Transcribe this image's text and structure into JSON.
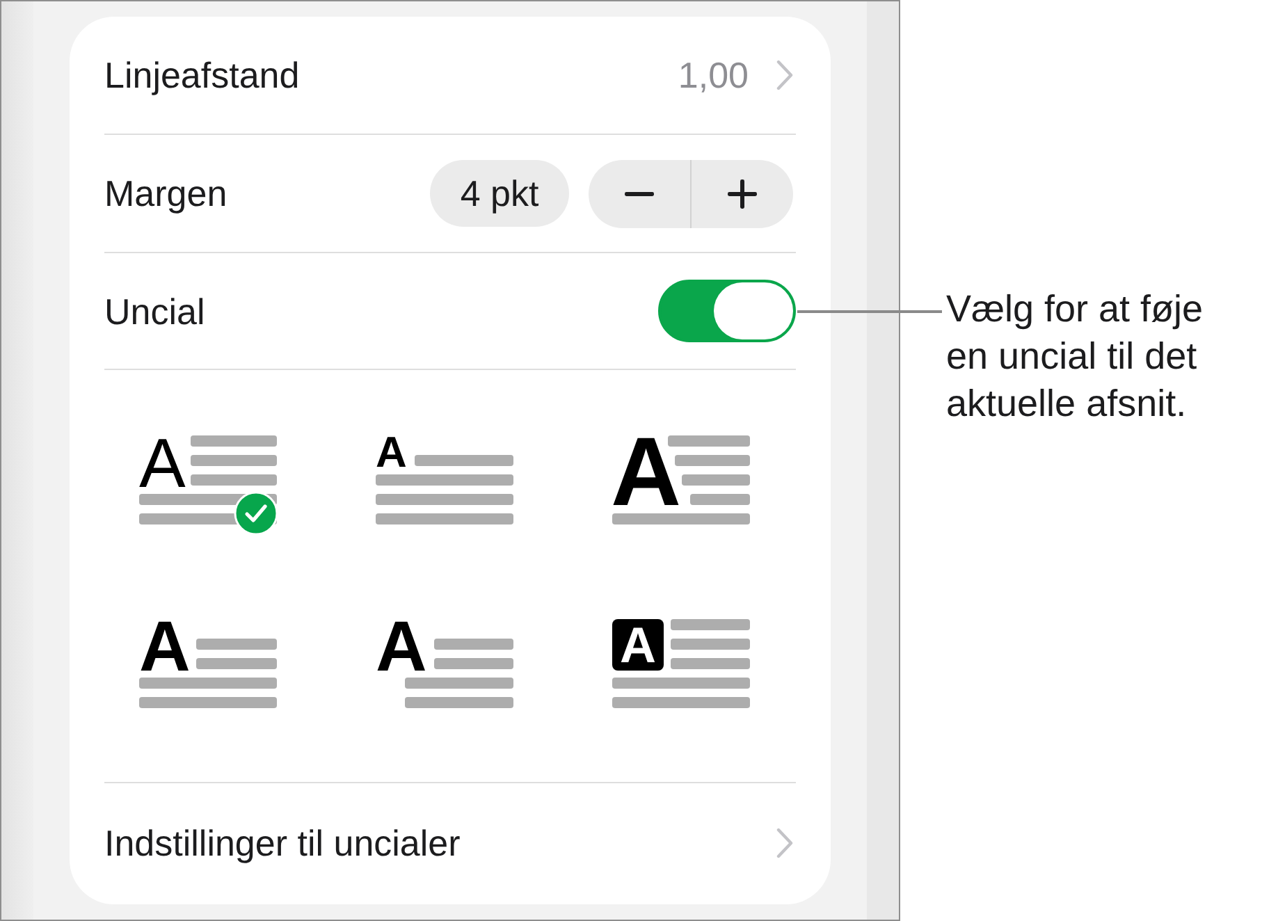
{
  "line_spacing": {
    "label": "Linjeafstand",
    "value": "1,00"
  },
  "margin": {
    "label": "Margen",
    "value": "4 pkt"
  },
  "drop_cap": {
    "label": "Uncial",
    "on": true
  },
  "drop_cap_styles": [
    {
      "kind": "light",
      "letter": "A",
      "selected": true
    },
    {
      "kind": "raised",
      "letter": "A",
      "selected": false
    },
    {
      "kind": "tall",
      "letter": "A",
      "selected": false
    },
    {
      "kind": "dropped",
      "letter": "A",
      "selected": false
    },
    {
      "kind": "hanging",
      "letter": "A",
      "selected": false
    },
    {
      "kind": "boxed",
      "letter": "A",
      "selected": false
    }
  ],
  "drop_cap_settings": {
    "label": "Indstillinger til uncialer"
  },
  "callout": {
    "text": "Vælg for at føje en uncial til det aktuelle afsnit."
  }
}
